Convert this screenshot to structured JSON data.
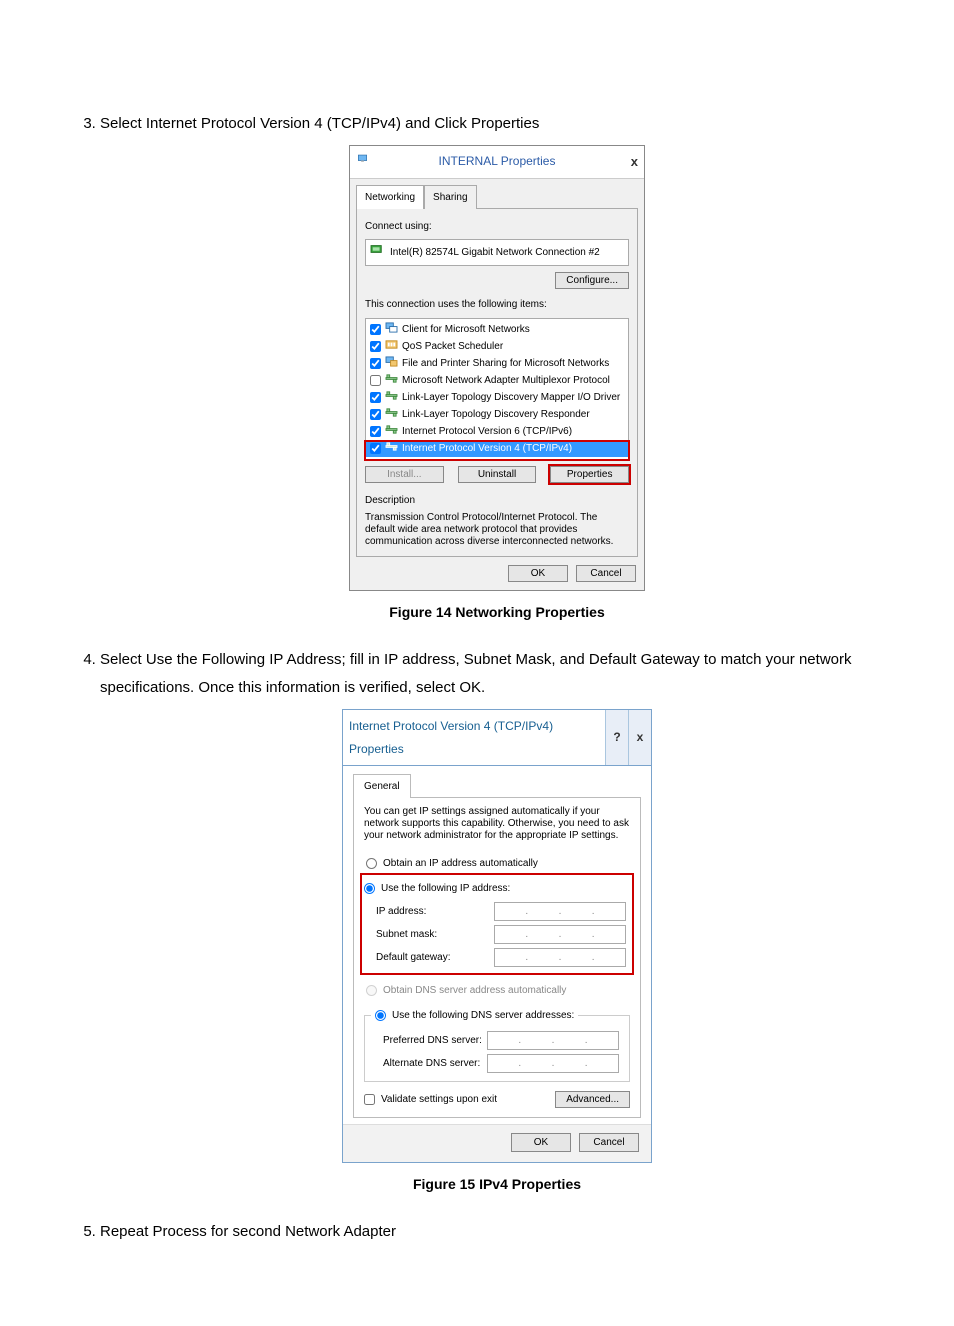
{
  "steps": {
    "s3": "Select Internet Protocol Version 4 (TCP/IPv4) and Click Properties",
    "s4": "Select Use the Following IP Address; fill in IP address, Subnet Mask, and Default Gateway to match your network specifications. Once this information is verified, select OK.",
    "s5": "Repeat Process for second Network Adapter"
  },
  "fig14": {
    "caption": "Figure 14 Networking Properties",
    "title": "INTERNAL Properties",
    "tab_networking": "Networking",
    "tab_sharing": "Sharing",
    "connect_using": "Connect using:",
    "adapter": "Intel(R) 82574L Gigabit Network Connection #2",
    "configure": "Configure...",
    "items_label": "This connection uses the following items:",
    "items": [
      {
        "checked": true,
        "icon": "client",
        "label": "Client for Microsoft Networks"
      },
      {
        "checked": true,
        "icon": "sched",
        "label": "QoS Packet Scheduler"
      },
      {
        "checked": true,
        "icon": "share",
        "label": "File and Printer Sharing for Microsoft Networks"
      },
      {
        "checked": false,
        "icon": "proto",
        "label": "Microsoft Network Adapter Multiplexor Protocol"
      },
      {
        "checked": true,
        "icon": "proto",
        "label": "Link-Layer Topology Discovery Mapper I/O Driver"
      },
      {
        "checked": true,
        "icon": "proto",
        "label": "Link-Layer Topology Discovery Responder"
      },
      {
        "checked": true,
        "icon": "proto",
        "label": "Internet Protocol Version 6 (TCP/IPv6)"
      },
      {
        "checked": true,
        "icon": "proto",
        "label": "Internet Protocol Version 4 (TCP/IPv4)"
      }
    ],
    "install": "Install...",
    "uninstall": "Uninstall",
    "properties": "Properties",
    "desc_label": "Description",
    "desc_text": "Transmission Control Protocol/Internet Protocol. The default wide area network protocol that provides communication across diverse interconnected networks.",
    "ok": "OK",
    "cancel": "Cancel"
  },
  "fig15": {
    "caption": "Figure 15 IPv4 Properties",
    "title": "Internet Protocol Version 4 (TCP/IPv4) Properties",
    "tab_general": "General",
    "blurb": "You can get IP settings assigned automatically if your network supports this capability. Otherwise, you need to ask your network administrator for the appropriate IP settings.",
    "r_auto_ip": "Obtain an IP address automatically",
    "r_use_ip": "Use the following IP address:",
    "ip_address": "IP address:",
    "subnet": "Subnet mask:",
    "gateway": "Default gateway:",
    "r_auto_dns": "Obtain DNS server address automatically",
    "r_use_dns": "Use the following DNS server addresses:",
    "pref_dns": "Preferred DNS server:",
    "alt_dns": "Alternate DNS server:",
    "validate": "Validate settings upon exit",
    "advanced": "Advanced...",
    "ok": "OK",
    "cancel": "Cancel"
  }
}
